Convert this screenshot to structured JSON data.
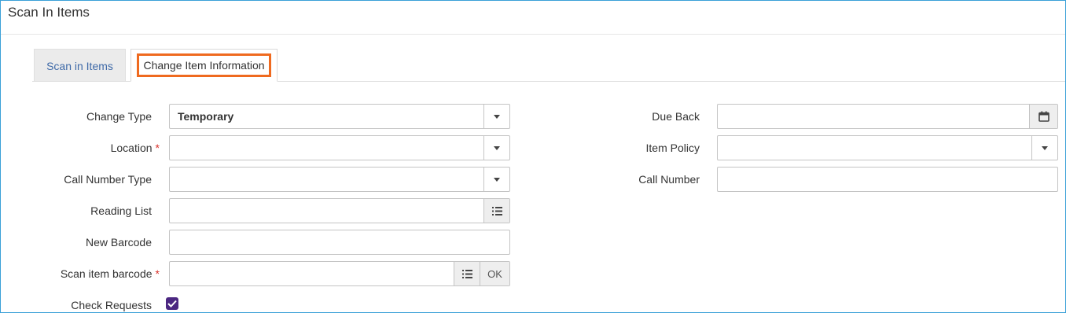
{
  "page": {
    "title": "Scan In Items"
  },
  "tabs": [
    {
      "label": "Scan in Items",
      "active": false
    },
    {
      "label": "Change Item Information",
      "active": true,
      "highlighted": true
    }
  ],
  "left_fields": {
    "change_type": {
      "label": "Change Type",
      "value": "Temporary"
    },
    "location": {
      "label": "Location",
      "required_mark": "*",
      "value": ""
    },
    "call_number_type": {
      "label": "Call Number Type",
      "value": ""
    },
    "reading_list": {
      "label": "Reading List",
      "value": ""
    },
    "new_barcode": {
      "label": "New Barcode",
      "value": ""
    },
    "scan_item_barcode": {
      "label": "Scan item barcode",
      "required_mark": "*",
      "value": "",
      "ok_label": "OK"
    },
    "check_requests": {
      "label": "Check Requests",
      "checked": true
    }
  },
  "right_fields": {
    "due_back": {
      "label": "Due Back",
      "value": ""
    },
    "item_policy": {
      "label": "Item Policy",
      "value": ""
    },
    "call_number": {
      "label": "Call Number",
      "value": ""
    }
  },
  "colors": {
    "frame_border": "#3aa0d8",
    "tab_highlight": "#ef6a1f",
    "link_blue": "#3f6aa8",
    "required_red": "#d9322b",
    "checkbox_purple": "#4b2781"
  },
  "icons": {
    "dropdown": "chevron-down-icon",
    "calendar": "calendar-icon",
    "list": "list-icon",
    "check": "checkmark-icon"
  }
}
